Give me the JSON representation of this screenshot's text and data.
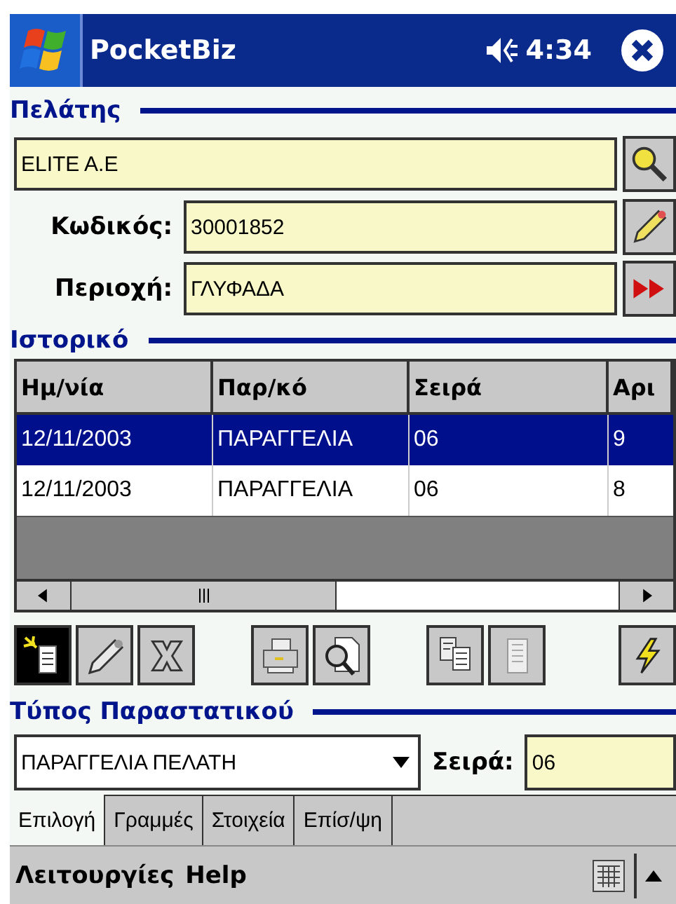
{
  "status_bar": {
    "title": "PocketBiz",
    "time": "4:34"
  },
  "customer": {
    "heading": "Πελάτης",
    "name": {
      "value": "ELITE A.E",
      "kind": "search"
    },
    "fields": [
      {
        "label": "Κωδικός:",
        "value": "30001852",
        "kind": "edit"
      },
      {
        "label": "Περιοχή:",
        "value": "ΓΛΥΦΑΔΑ",
        "kind": "forward"
      }
    ]
  },
  "history": {
    "heading": "Ιστορικό",
    "columns": [
      "Ημ/νία",
      "Παρ/κό",
      "Σειρά",
      "Αρι"
    ],
    "rows": [
      {
        "cells": [
          "12/11/2003",
          "ΠΑΡΑΓΓΕΛΙΑ",
          "06",
          "9"
        ],
        "selected": true
      },
      {
        "cells": [
          "12/11/2003",
          "ΠΑΡΑΓΓΕΛΙΑ",
          "06",
          "8"
        ],
        "selected": false
      }
    ]
  },
  "toolbar": {
    "groups": [
      {
        "tools": [
          {
            "kind": "new",
            "active": true
          },
          {
            "kind": "edit",
            "active": false
          },
          {
            "kind": "delete",
            "active": false
          }
        ]
      },
      {
        "tools": [
          {
            "kind": "print",
            "active": false
          },
          {
            "kind": "preview",
            "active": false
          }
        ]
      },
      {
        "tools": [
          {
            "kind": "copy",
            "active": false
          },
          {
            "kind": "paste",
            "active": false
          }
        ]
      },
      {
        "tools": [
          {
            "kind": "run",
            "active": false
          }
        ]
      }
    ]
  },
  "document_type": {
    "heading": "Τύπος Παραστατικού",
    "type": "ΠΑΡΑΓΓΕΛΙΑ ΠΕΛΑΤΗ",
    "series_label": "Σειρά:",
    "series": "06"
  },
  "tabs": [
    {
      "label": "Επιλογή",
      "selected": true
    },
    {
      "label": "Γραμμές",
      "selected": false
    },
    {
      "label": "Στοιχεία",
      "selected": false
    },
    {
      "label": "Επίσ/ψη",
      "selected": false
    }
  ],
  "menu_bar": {
    "items": [
      "Λειτουργίες",
      "Help"
    ]
  }
}
